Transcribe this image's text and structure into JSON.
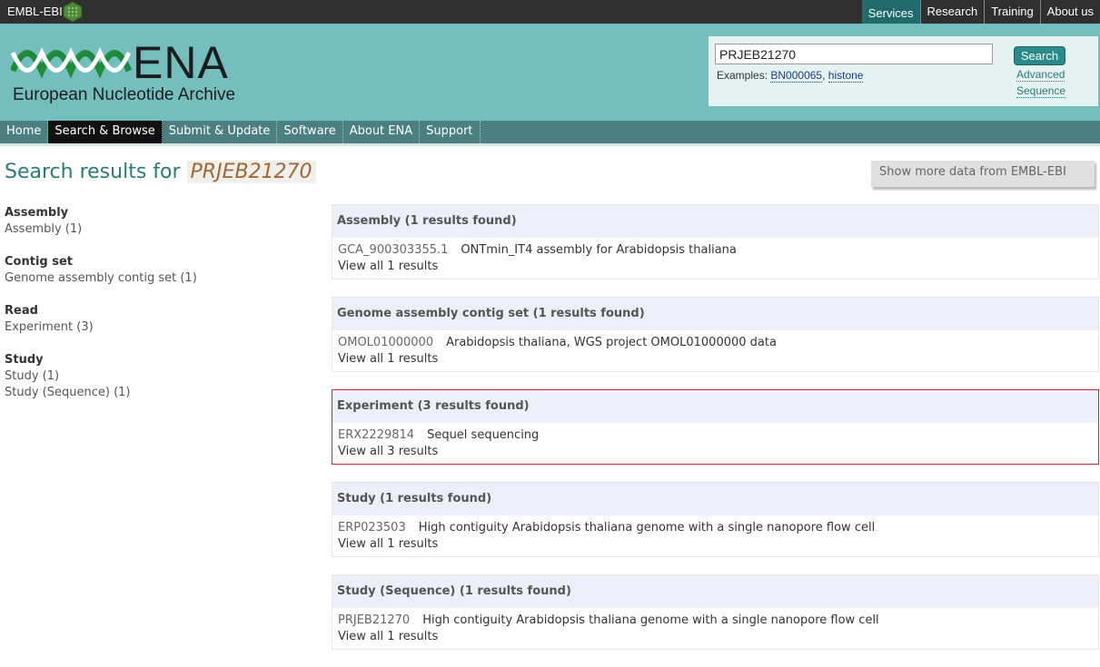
{
  "global": {
    "brand": "EMBL-EBI",
    "links": [
      {
        "label": "Services"
      },
      {
        "label": "Research"
      },
      {
        "label": "Training"
      },
      {
        "label": "About us"
      }
    ]
  },
  "masthead": {
    "logo_text": "ENA",
    "logo_subtitle": "European Nucleotide Archive",
    "search": {
      "value": "PRJEB21270",
      "button": "Search",
      "examples_label": "Examples:",
      "example1": "BN000065",
      "example2": "histone",
      "advanced": "Advanced",
      "sequence": "Sequence"
    }
  },
  "nav": {
    "items": [
      {
        "label": "Home"
      },
      {
        "label": "Search & Browse"
      },
      {
        "label": "Submit & Update"
      },
      {
        "label": "Software"
      },
      {
        "label": "About ENA"
      },
      {
        "label": "Support"
      }
    ]
  },
  "page": {
    "title_prefix": "Search results for",
    "query": "PRJEB21270",
    "more_data": "Show more data from EMBL-EBI"
  },
  "facets": [
    {
      "title": "Assembly",
      "items": [
        "Assembly (1)"
      ]
    },
    {
      "title": "Contig set",
      "items": [
        "Genome assembly contig set (1)"
      ]
    },
    {
      "title": "Read",
      "items": [
        "Experiment (3)"
      ]
    },
    {
      "title": "Study",
      "items": [
        "Study (1)",
        "Study (Sequence) (1)"
      ]
    }
  ],
  "results": [
    {
      "heading": "Assembly (1 results found)",
      "accession": "GCA_900303355.1",
      "description": "ONTmin_IT4 assembly for Arabidopsis thaliana",
      "view_all": "View all 1 results"
    },
    {
      "heading": "Genome assembly contig set (1 results found)",
      "accession": "OMOL01000000",
      "description": "Arabidopsis thaliana, WGS project OMOL01000000 data",
      "view_all": "View all 1 results"
    },
    {
      "heading": "Experiment (3 results found)",
      "accession": "ERX2229814",
      "description": "Sequel sequencing",
      "view_all": "View all 3 results"
    },
    {
      "heading": "Study (1 results found)",
      "accession": "ERP023503",
      "description": "High contiguity Arabidopsis thaliana genome with a single nanopore flow cell",
      "view_all": "View all 1 results"
    },
    {
      "heading": "Study (Sequence) (1 results found)",
      "accession": "PRJEB21270",
      "description": "High contiguity Arabidopsis thaliana genome with a single nanopore flow cell",
      "view_all": "View all 1 results"
    }
  ],
  "colors": {
    "masthead": "#74bebe",
    "nav": "#4c8080",
    "highlight_border": "#d2232a"
  }
}
